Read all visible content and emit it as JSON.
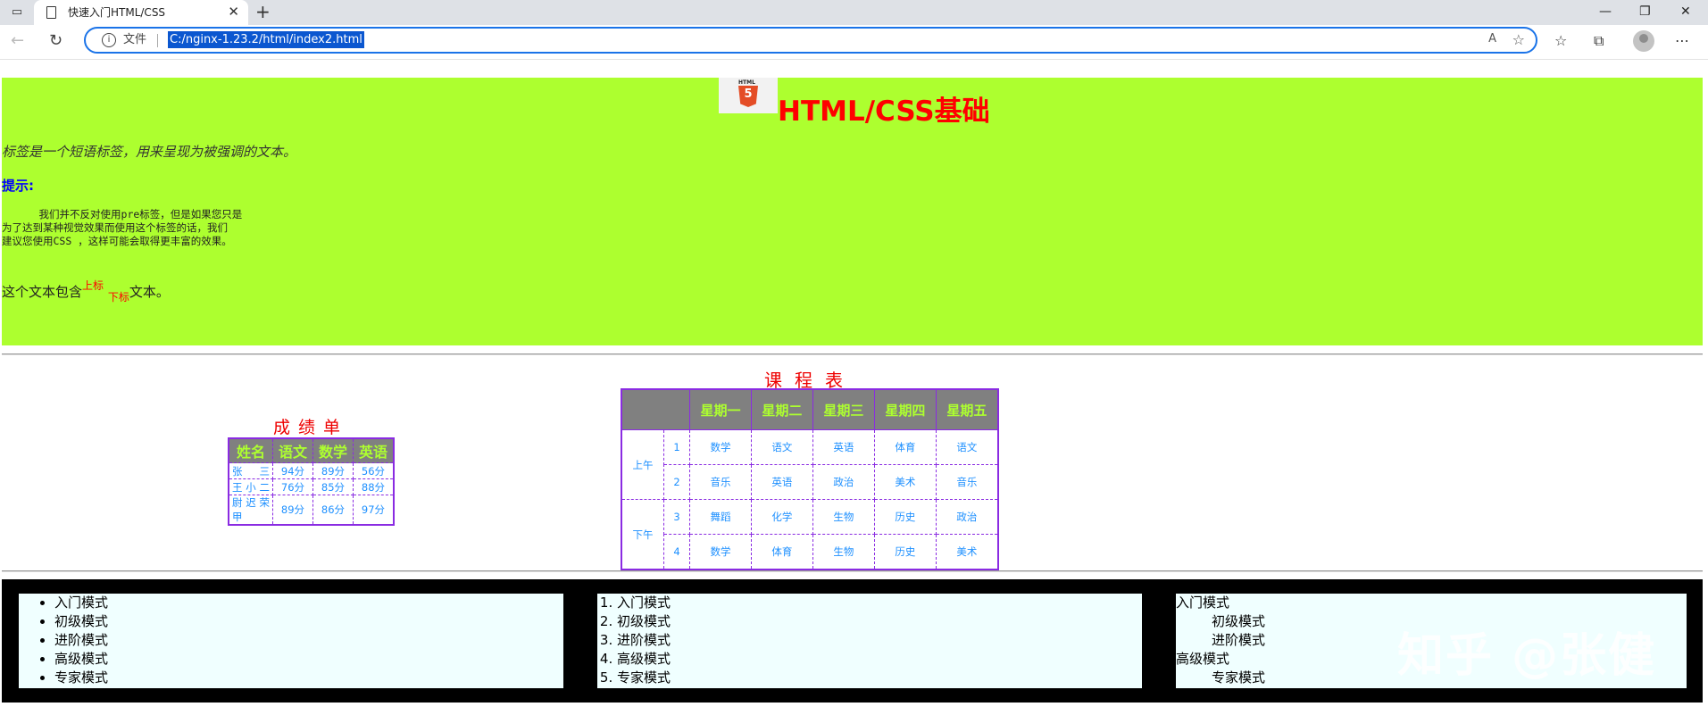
{
  "browser": {
    "tab_title": "快速入门HTML/CSS",
    "address_scheme": "文件",
    "url": "C:/nginx-1.23.2/html/index2.html"
  },
  "header": {
    "logo_label": "HTML",
    "logo_number": "5",
    "title": "HTML/CSS基础",
    "em_text": "标签是一个短语标签，用来呈现为被强调的文本。",
    "tip_heading": "提示:",
    "pre_text": "      我们并不反对使用pre标签，但是如果您只是\n为了达到某种视觉效果而使用这个标签的话，我们\n建议您使用CSS ，这样可能会取得更丰富的效果。",
    "subsup": {
      "before": "这个文本包含",
      "sup": "上标",
      "sub": "下标",
      "after": "文本。"
    }
  },
  "score_table": {
    "caption": "成绩单",
    "headers": [
      "姓名",
      "语文",
      "数学",
      "英语"
    ],
    "rows": [
      [
        "张三",
        "94分",
        "89分",
        "56分"
      ],
      [
        "王小二",
        "76分",
        "85分",
        "88分"
      ],
      [
        "尉迟荣甲",
        "89分",
        "86分",
        "97分"
      ]
    ]
  },
  "schedule_table": {
    "caption": "课程表",
    "headers": [
      "星期一",
      "星期二",
      "星期三",
      "星期四",
      "星期五"
    ],
    "periods": [
      "上午",
      "下午"
    ],
    "rows": [
      {
        "num": "1",
        "courses": [
          "数学",
          "语文",
          "英语",
          "体育",
          "语文"
        ]
      },
      {
        "num": "2",
        "courses": [
          "音乐",
          "英语",
          "政治",
          "美术",
          "音乐"
        ]
      },
      {
        "num": "3",
        "courses": [
          "舞蹈",
          "化学",
          "生物",
          "历史",
          "政治"
        ]
      },
      {
        "num": "4",
        "courses": [
          "数学",
          "体育",
          "生物",
          "历史",
          "美术"
        ]
      }
    ]
  },
  "lists": {
    "unordered": [
      "入门模式",
      "初级模式",
      "进阶模式",
      "高级模式",
      "专家模式"
    ],
    "ordered": [
      "入门模式",
      "初级模式",
      "进阶模式",
      "高级模式",
      "专家模式"
    ],
    "definition": [
      {
        "term": "入门模式",
        "defs": [
          "初级模式",
          "进阶模式"
        ]
      },
      {
        "term": "高级模式",
        "defs": [
          "专家模式"
        ]
      }
    ]
  },
  "watermark": "知乎 @张健",
  "colors": {
    "header_bg": "#adff2f",
    "title": "#ff0000",
    "table_border": "#8a2be2",
    "table_header_bg": "#808080",
    "table_header_text": "#adff2f",
    "cell_text": "#1e90ff",
    "list_box_bg": "#f0ffff"
  }
}
